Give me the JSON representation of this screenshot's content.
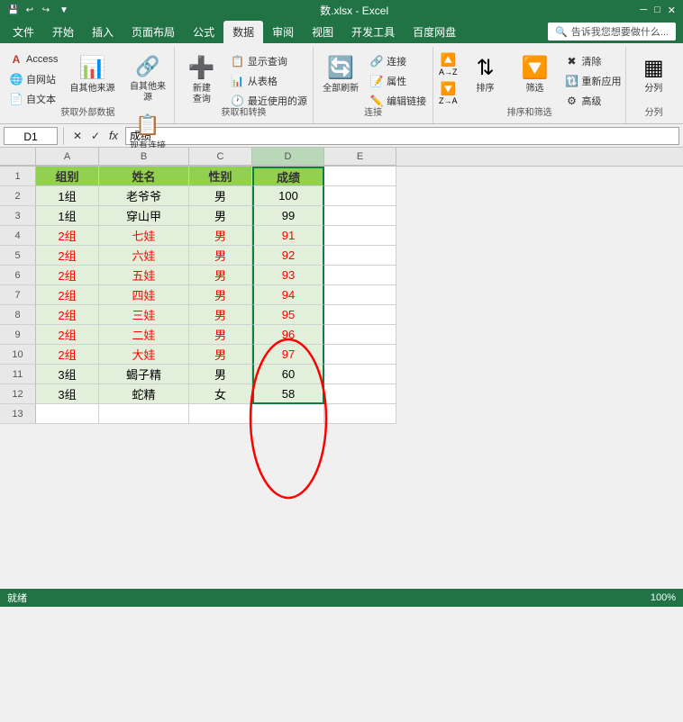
{
  "titlebar": {
    "filename": "数.xlsx - Excel",
    "quickaccess": [
      "save",
      "undo",
      "redo",
      "customize"
    ]
  },
  "tabs": [
    {
      "label": "文件",
      "active": false
    },
    {
      "label": "开始",
      "active": false
    },
    {
      "label": "插入",
      "active": false
    },
    {
      "label": "页面布局",
      "active": false
    },
    {
      "label": "公式",
      "active": false
    },
    {
      "label": "数据",
      "active": true
    },
    {
      "label": "审阅",
      "active": false
    },
    {
      "label": "视图",
      "active": false
    },
    {
      "label": "开发工具",
      "active": false
    },
    {
      "label": "百度网盘",
      "active": false
    }
  ],
  "help_text": "告诉我您想要做什么...",
  "ribbon": {
    "groups": [
      {
        "label": "获取外部数据",
        "buttons": [
          {
            "id": "access",
            "label": "Access",
            "type": "small"
          },
          {
            "id": "web",
            "label": "自网站",
            "type": "small"
          },
          {
            "id": "text",
            "label": "自文本",
            "type": "small"
          },
          {
            "id": "other",
            "label": "自其他来源",
            "type": "large"
          },
          {
            "id": "existing",
            "label": "现有连接",
            "type": "large"
          }
        ]
      },
      {
        "label": "获取和转换",
        "buttons": [
          {
            "id": "new-query",
            "label": "新建\n查询",
            "type": "large"
          },
          {
            "id": "show-query",
            "label": "显示查询",
            "type": "small"
          },
          {
            "id": "from-table",
            "label": "从表格",
            "type": "small"
          },
          {
            "id": "recent-sources",
            "label": "最近使用的源",
            "type": "small"
          }
        ]
      },
      {
        "label": "连接",
        "buttons": [
          {
            "id": "refresh-all",
            "label": "全部刷新",
            "type": "large"
          },
          {
            "id": "connections",
            "label": "连接",
            "type": "small"
          },
          {
            "id": "properties",
            "label": "属性",
            "type": "small"
          },
          {
            "id": "edit-links",
            "label": "编辑链接",
            "type": "small"
          }
        ]
      },
      {
        "label": "排序和筛选",
        "buttons": [
          {
            "id": "sort-az",
            "label": "AZ↑",
            "type": "sort"
          },
          {
            "id": "sort-za",
            "label": "ZA↓",
            "type": "sort"
          },
          {
            "id": "sort",
            "label": "排序",
            "type": "large"
          },
          {
            "id": "filter",
            "label": "筛选",
            "type": "large"
          },
          {
            "id": "clear",
            "label": "清除",
            "type": "small"
          },
          {
            "id": "reapply",
            "label": "重新应用",
            "type": "small"
          },
          {
            "id": "advanced",
            "label": "高级",
            "type": "small"
          }
        ]
      },
      {
        "label": "分列",
        "buttons": [
          {
            "id": "split",
            "label": "分列",
            "type": "large"
          }
        ]
      }
    ]
  },
  "formulabar": {
    "cell_ref": "D1",
    "formula": "成绩"
  },
  "columns": [
    "A",
    "B",
    "C",
    "D",
    "E"
  ],
  "col_headers": [
    "组别",
    "姓名",
    "性别",
    "成绩"
  ],
  "rows": [
    {
      "num": "1",
      "cells": [
        "组别",
        "姓名",
        "性别",
        "成绩"
      ],
      "type": "header"
    },
    {
      "num": "2",
      "cells": [
        "1组",
        "老爷爷",
        "男",
        "100"
      ],
      "type": "normal"
    },
    {
      "num": "3",
      "cells": [
        "1组",
        "穿山甲",
        "男",
        "99"
      ],
      "type": "normal"
    },
    {
      "num": "4",
      "cells": [
        "2组",
        "七娃",
        "男",
        "91"
      ],
      "type": "red"
    },
    {
      "num": "5",
      "cells": [
        "2组",
        "六娃",
        "男",
        "92"
      ],
      "type": "red"
    },
    {
      "num": "6",
      "cells": [
        "2组",
        "五娃",
        "男",
        "93"
      ],
      "type": "red"
    },
    {
      "num": "7",
      "cells": [
        "2组",
        "四娃",
        "男",
        "94"
      ],
      "type": "red"
    },
    {
      "num": "8",
      "cells": [
        "2组",
        "三娃",
        "男",
        "95"
      ],
      "type": "red"
    },
    {
      "num": "9",
      "cells": [
        "2组",
        "二娃",
        "男",
        "96"
      ],
      "type": "red"
    },
    {
      "num": "10",
      "cells": [
        "2组",
        "大娃",
        "男",
        "97"
      ],
      "type": "red"
    },
    {
      "num": "11",
      "cells": [
        "3组",
        "蝎子精",
        "男",
        "60"
      ],
      "type": "normal"
    },
    {
      "num": "12",
      "cells": [
        "3组",
        "蛇精",
        "女",
        "58"
      ],
      "type": "normal"
    }
  ],
  "statusbar": {
    "mode": "就绪",
    "zoom": "100%"
  }
}
